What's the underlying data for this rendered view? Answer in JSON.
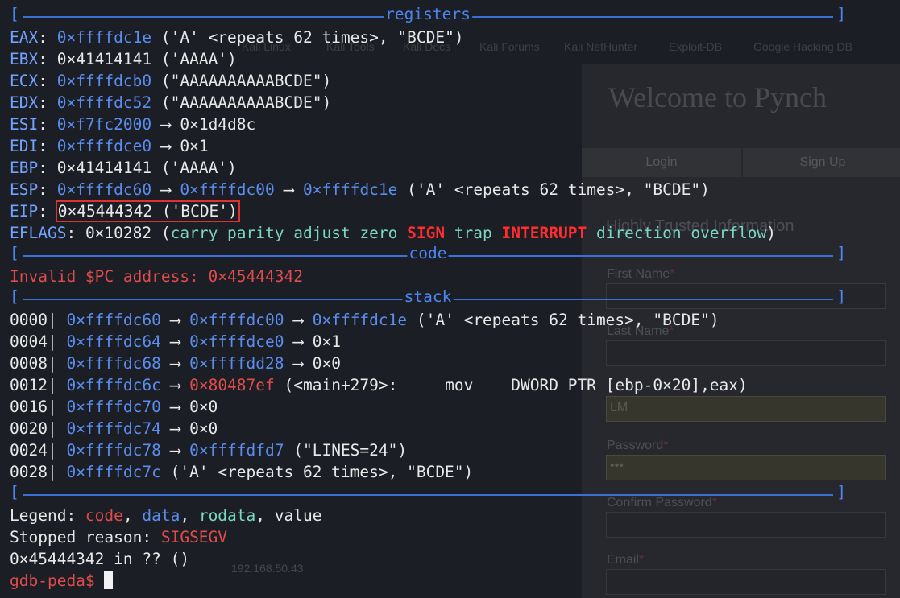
{
  "background": {
    "title": "Welcome to Pynch",
    "tabs": [
      "Login",
      "Sign Up"
    ],
    "section_heading": "Highly Trusted Information",
    "fields": [
      {
        "label": "First Name",
        "value": ""
      },
      {
        "label": "Last Name",
        "value": ""
      },
      {
        "label": "Username",
        "value": "LM"
      },
      {
        "label": "Password",
        "value": "•••"
      },
      {
        "label": "Confirm Password",
        "value": ""
      },
      {
        "label": "Email",
        "value": ""
      }
    ],
    "bookmarks": [
      "Kali Linux",
      "Kali Tools",
      "Kali Docs",
      "Kali Forums",
      "Kali NetHunter",
      "Exploit-DB",
      "Google Hacking DB"
    ],
    "ip": "192.168.50.43",
    "required_mark": "*"
  },
  "sections": {
    "registers": "registers",
    "code": "code",
    "stack": "stack",
    "bracket_left": "[",
    "bracket_right": "]"
  },
  "registers": {
    "eax": {
      "name": "EAX",
      "addr": "0×ffffdc1e",
      "rest": " ('A' <repeats 62 times>, \"BCDE\")"
    },
    "ebx": {
      "name": "EBX",
      "rest": " 0×41414141 ('AAAA')"
    },
    "ecx": {
      "name": "ECX",
      "addr": "0×ffffdcb0",
      "rest": " (\"AAAAAAAAAABCDE\")"
    },
    "edx": {
      "name": "EDX",
      "addr": "0×ffffdc52",
      "rest": " (\"AAAAAAAAAABCDE\")"
    },
    "esi": {
      "name": "ESI",
      "addr": "0×f7fc2000",
      "rest": " ⟶ 0×1d4d8c"
    },
    "edi": {
      "name": "EDI",
      "addr": "0×ffffdce0",
      "rest": " ⟶ 0×1"
    },
    "ebp": {
      "name": "EBP",
      "rest": " 0×41414141 ('AAAA')"
    },
    "esp": {
      "name": "ESP",
      "addr1": "0×ffffdc60",
      "arrow": " ⟶ ",
      "addr2": "0×ffffdc00",
      "addr3": "0×ffffdc1e",
      "rest": " ('A' <repeats 62 times>, \"BCDE\")"
    },
    "eip": {
      "name": "EIP",
      "value": "0×45444342 ('BCDE')"
    },
    "eflags": {
      "name": "EFLAGS",
      "value": " 0×10282 (",
      "carry": "carry parity adjust zero ",
      "sign": "SIGN",
      "trap": " trap ",
      "interrupt": "INTERRUPT",
      "tail": " direction overflow",
      "close": ")"
    }
  },
  "code": {
    "invalid_pc": "Invalid $PC address: 0×45444342"
  },
  "stack": [
    {
      "offset": "0000|",
      "addr": "0×ffffdc60",
      "arrow": " ⟶ ",
      "p1": "0×ffffdc00",
      "p2": "0×ffffdc1e",
      "rest": " ('A' <repeats 62 times>, \"BCDE\")"
    },
    {
      "offset": "0004|",
      "addr": "0×ffffdc64",
      "arrow": " ⟶ ",
      "p1": "0×ffffdce0",
      "rest": " ⟶ 0×1"
    },
    {
      "offset": "0008|",
      "addr": "0×ffffdc68",
      "arrow": " ⟶ ",
      "p1": "0×ffffdd28",
      "rest": " ⟶ 0×0"
    },
    {
      "offset": "0012|",
      "addr": "0×ffffdc6c",
      "arrow": " ⟶ ",
      "code": "0×80487ef",
      "rest": " (<main+279>:     mov    DWORD PTR [ebp-0×20],eax)"
    },
    {
      "offset": "0016|",
      "addr": "0×ffffdc70",
      "rest": " ⟶ 0×0"
    },
    {
      "offset": "0020|",
      "addr": "0×ffffdc74",
      "rest": " ⟶ 0×0"
    },
    {
      "offset": "0024|",
      "addr": "0×ffffdc78",
      "arrow": " ⟶ ",
      "p1": "0×ffffdfd7",
      "rest": " (\"LINES=24\")"
    },
    {
      "offset": "0028|",
      "addr": "0×ffffdc7c",
      "rest": " ('A' <repeats 62 times>, \"BCDE\")"
    }
  ],
  "legend": {
    "prefix": "Legend: ",
    "code": "code",
    "data": "data",
    "rodata": "rodata",
    "value": "value",
    "comma": ", "
  },
  "stopped": {
    "prefix": "Stopped reason: ",
    "reason": "SIGSEGV"
  },
  "location": "0×45444342 in ?? ()",
  "prompt": "gdb-peda$ ",
  "colors": {
    "background": "#1b1e24",
    "register_name": "#72a2ff",
    "data_address": "#5b8def",
    "code_address": "#e04c4c",
    "rodata": "#79d7c2",
    "separator": "#3b6fd4",
    "eip_highlight": "#e03131",
    "flag_set": "#ff2d2d"
  }
}
